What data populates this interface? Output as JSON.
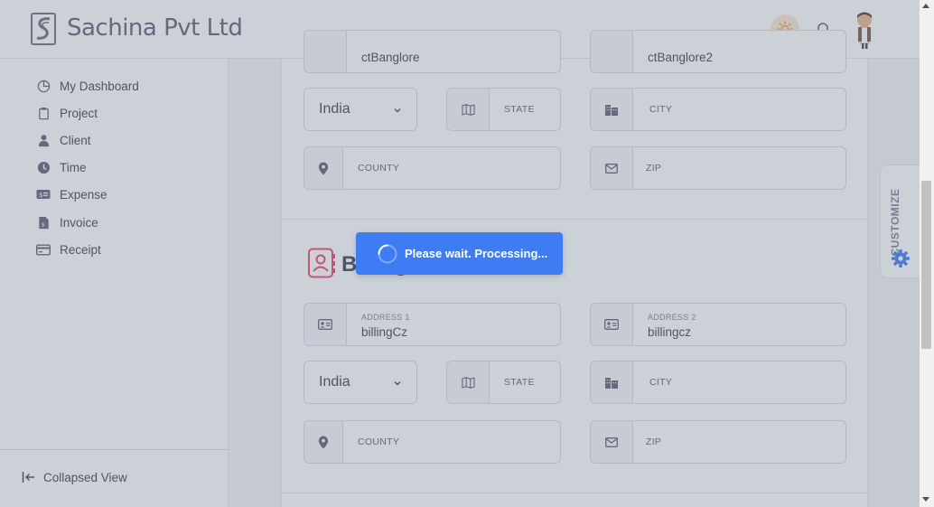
{
  "header": {
    "brand": "Sachina Pvt Ltd",
    "icons": [
      "logo-icon",
      "sun-icon",
      "bell-icon",
      "avatar"
    ]
  },
  "sidebar": {
    "items": [
      {
        "label": "My Dashboard",
        "icon": "pie-chart-icon"
      },
      {
        "label": "Project",
        "icon": "clipboard-icon"
      },
      {
        "label": "Client",
        "icon": "user-icon"
      },
      {
        "label": "Time",
        "icon": "clock-icon"
      },
      {
        "label": "Expense",
        "icon": "money-icon"
      },
      {
        "label": "Invoice",
        "icon": "invoice-file-icon"
      },
      {
        "label": "Receipt",
        "icon": "receipt-card-icon"
      }
    ],
    "collapse_label": "Collapsed View"
  },
  "shipping": {
    "address1_value": "ctBanglore",
    "address2_value": "ctBanglore2",
    "country": "India",
    "state_label": "STATE",
    "city_label": "CITY",
    "county_label": "COUNTY",
    "zip_label": "ZIP"
  },
  "billing": {
    "title": "Billing",
    "address1_label": "ADDRESS 1",
    "address1_value": "billingCz",
    "address2_label": "ADDRESS 2",
    "address2_value": "billingcz",
    "country": "India",
    "state_label": "STATE",
    "city_label": "CITY",
    "county_label": "COUNTY",
    "zip_label": "ZIP"
  },
  "customize": {
    "label": "CUSTOMIZE"
  },
  "loader": {
    "message": "Please wait. Processing..."
  },
  "colors": {
    "accent": "#3e7cf4",
    "overlay": "rgba(110,120,140,0.35)",
    "theme_button_bg": "#fde8d4",
    "billing_icon": "#f1416c"
  }
}
